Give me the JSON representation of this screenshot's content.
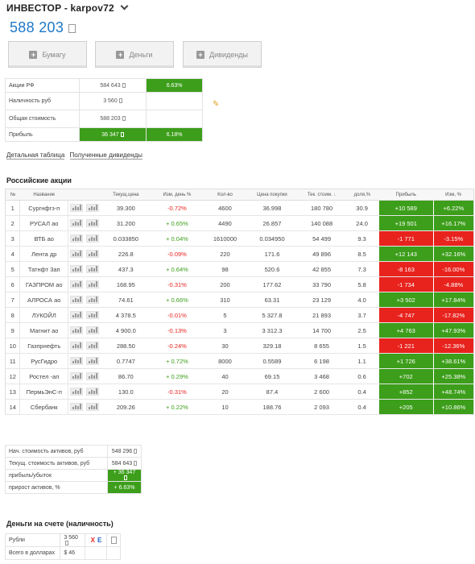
{
  "header": {
    "title": "ИНВЕСТОР - karpov72"
  },
  "portfolio": {
    "total": "588 203"
  },
  "buttons": [
    {
      "label": "Бумагу"
    },
    {
      "label": "Деньги"
    },
    {
      "label": "Дивиденды"
    }
  ],
  "summary": {
    "rows": [
      {
        "label": "Акции РФ",
        "value": "584 643",
        "pct": "6.63%"
      },
      {
        "label": "Наличность руб",
        "value": "3 560",
        "pct": ""
      },
      {
        "label": "Общая стоимость",
        "value": "588 203",
        "pct": ""
      },
      {
        "label": "Прибыль",
        "value": "36 347",
        "pct": "6.18%"
      }
    ]
  },
  "links": {
    "detail": "Детальная таблица",
    "dividends": "Полученные дивиденды"
  },
  "stocks": {
    "title": "Российские акции",
    "columns": [
      "№",
      "Название",
      "",
      "",
      "Текущ.цена",
      "Изм, день %",
      "Кол-во",
      "Цена покупки",
      "Тек. стоим.",
      "доля,%",
      "Прибыль",
      "Изм, %"
    ],
    "sort_icon": "↓",
    "rows": [
      {
        "n": "1",
        "name": "Сургнфгз-п",
        "price": "39.300",
        "day": "-0.72%",
        "qty": "4600",
        "buy": "36.998",
        "value": "180 780",
        "share": "30.9",
        "profit": "+10 589",
        "chg": "+6.22%"
      },
      {
        "n": "2",
        "name": "РУСАЛ ао",
        "price": "31.200",
        "day": "+ 0.65%",
        "qty": "4490",
        "buy": "26.857",
        "value": "140 088",
        "share": "24.0",
        "profit": "+19 501",
        "chg": "+16.17%"
      },
      {
        "n": "3",
        "name": "ВТБ ао",
        "price": "0.033850",
        "day": "+ 0.04%",
        "qty": "1610000",
        "buy": "0.034950",
        "value": "54 499",
        "share": "9.3",
        "profit": "-1 771",
        "chg": "-3.15%"
      },
      {
        "n": "4",
        "name": "Лента др",
        "price": "226.8",
        "day": "-0.09%",
        "qty": "220",
        "buy": "171.6",
        "value": "49 896",
        "share": "8.5",
        "profit": "+12 143",
        "chg": "+32.16%"
      },
      {
        "n": "5",
        "name": "Татнфт 3ап",
        "price": "437.3",
        "day": "+ 0.64%",
        "qty": "98",
        "buy": "520.6",
        "value": "42 855",
        "share": "7.3",
        "profit": "-8 163",
        "chg": "-16.00%"
      },
      {
        "n": "6",
        "name": "ГАЗПРОМ ао",
        "price": "168.95",
        "day": "-0.31%",
        "qty": "200",
        "buy": "177.62",
        "value": "33 790",
        "share": "5.8",
        "profit": "-1 734",
        "chg": "-4.88%"
      },
      {
        "n": "7",
        "name": "АЛРОСА ао",
        "price": "74.61",
        "day": "+ 0.66%",
        "qty": "310",
        "buy": "63.31",
        "value": "23 129",
        "share": "4.0",
        "profit": "+3 502",
        "chg": "+17.84%"
      },
      {
        "n": "8",
        "name": "ЛУКОЙЛ",
        "price": "4 378.5",
        "day": "-0.01%",
        "qty": "5",
        "buy": "5 327.8",
        "value": "21 893",
        "share": "3.7",
        "profit": "-4 747",
        "chg": "-17.82%"
      },
      {
        "n": "9",
        "name": "Магнит ао",
        "price": "4 900.0",
        "day": "-0.13%",
        "qty": "3",
        "buy": "3 312.3",
        "value": "14 700",
        "share": "2.5",
        "profit": "+4 763",
        "chg": "+47.93%"
      },
      {
        "n": "10",
        "name": "Газпрнефть",
        "price": "288.50",
        "day": "-0.24%",
        "qty": "30",
        "buy": "329.18",
        "value": "8 655",
        "share": "1.5",
        "profit": "-1 221",
        "chg": "-12.36%"
      },
      {
        "n": "11",
        "name": "РусГидро",
        "price": "0.7747",
        "day": "+ 0.72%",
        "qty": "8000",
        "buy": "0.5589",
        "value": "6 198",
        "share": "1.1",
        "profit": "+1 726",
        "chg": "+38.61%"
      },
      {
        "n": "12",
        "name": "Ростел -ап",
        "price": "86.70",
        "day": "+ 0.29%",
        "qty": "40",
        "buy": "69.15",
        "value": "3 468",
        "share": "0.6",
        "profit": "+702",
        "chg": "+25.38%"
      },
      {
        "n": "13",
        "name": "ПермьЭнС-п",
        "price": "130.0",
        "day": "-0.31%",
        "qty": "20",
        "buy": "87.4",
        "value": "2 600",
        "share": "0.4",
        "profit": "+852",
        "chg": "+48.74%"
      },
      {
        "n": "14",
        "name": "Сбербанк",
        "price": "209.26",
        "day": "+ 0.22%",
        "qty": "10",
        "buy": "188.76",
        "value": "2 093",
        "share": "0.4",
        "profit": "+205",
        "chg": "+10.86%"
      }
    ]
  },
  "totals": {
    "rows": [
      {
        "label": "Нач. стоимость активов, руб",
        "value": "548 296"
      },
      {
        "label": "Текущ. стоимость активов, руб",
        "value": "584 643"
      },
      {
        "label": "прибыль/убыток",
        "value": "+ 36 347"
      },
      {
        "label": "прирост активов, %",
        "value": "+ 6.63%"
      }
    ]
  },
  "cash": {
    "title": "Деньги на счете (наличность)",
    "rows": [
      {
        "label": "Рубли",
        "value": "3 560",
        "x": "X",
        "e": "E"
      },
      {
        "label": "Всего в долларах",
        "value": "$ 46"
      }
    ]
  },
  "colors": {
    "accent": "#1f78c8",
    "positive": "#3c9e1a",
    "negative": "#e8231e"
  },
  "icons": [
    "chevron-down-icon",
    "plus-icon",
    "pencil-icon",
    "chart-icon",
    "bars-icon",
    "document-icon"
  ]
}
